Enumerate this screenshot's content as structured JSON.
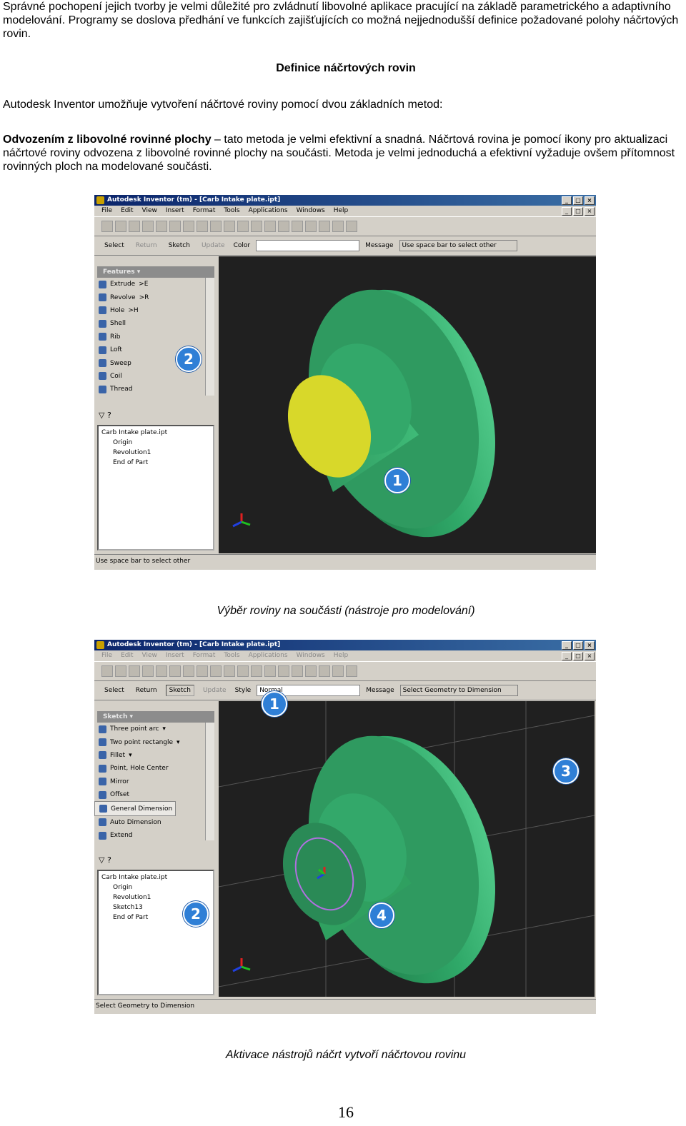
{
  "intro": "Správné pochopení jejich tvorby je velmi důležité pro zvládnutí libovolné aplikace pracující na základě parametrického a adaptivního modelování. Programy se doslova předhání ve funkcích zajišťujících co možná nejjednodušší definice požadované polohy náčrtových rovin.",
  "heading": "Definice náčrtových rovin",
  "para1": "Autodesk Inventor umožňuje vytvoření náčrtové roviny pomocí dvou základních metod:",
  "para2_bold": "Odvozením z libovolné rovinné plochy",
  "para2_rest": " – tato metoda je velmi efektivní a snadná. Náčrtová rovina je pomocí ikony pro aktualizaci náčrtové roviny odvozena z libovolné rovinné plochy na součásti. Metoda je velmi jednoduchá a efektivní vyžaduje ovšem přítomnost rovinných ploch na modelované součásti.",
  "caption1": "Výběr roviny na součásti (nástroje pro modelování)",
  "caption2": "Aktivace nástrojů náčrt vytvoří náčrtovou rovinu",
  "page_number": "16",
  "window_title": "Autodesk Inventor (tm) - [Carb Intake plate.ipt]",
  "menu": [
    "File",
    "Edit",
    "View",
    "Insert",
    "Format",
    "Tools",
    "Applications",
    "Windows",
    "Help"
  ],
  "shot1": {
    "select": "Select",
    "return": "Return",
    "sketch": "Sketch",
    "update": "Update",
    "style_label": "Color",
    "style_value": "",
    "message_label": "Message",
    "message": "Use space bar to select other",
    "panel_title": "Features ▾",
    "items": [
      {
        "label": "Extrude",
        "key": ">E"
      },
      {
        "label": "Revolve",
        "key": ">R"
      },
      {
        "label": "Hole",
        "key": ">H"
      },
      {
        "label": "Shell",
        "key": ""
      },
      {
        "label": "Rib",
        "key": ""
      },
      {
        "label": "Loft",
        "key": ""
      },
      {
        "label": "Sweep",
        "key": ""
      },
      {
        "label": "Coil",
        "key": ""
      },
      {
        "label": "Thread",
        "key": ""
      }
    ],
    "tree": [
      "Carb Intake plate.ipt",
      "Origin",
      "Revolution1",
      "End of Part"
    ],
    "status": "Use space bar to select other",
    "callouts": [
      "1",
      "2"
    ]
  },
  "shot2": {
    "select": "Select",
    "return": "Return",
    "sketch": "Sketch",
    "update": "Update",
    "style_label": "Style",
    "style_value": "Normal",
    "message_label": "Message",
    "message": "Select Geometry to Dimension",
    "panel_title": "Sketch ▾",
    "items": [
      {
        "label": "Three point arc",
        "key": "▾"
      },
      {
        "label": "Two point rectangle",
        "key": "▾"
      },
      {
        "label": "Fillet",
        "key": "▾"
      },
      {
        "label": "Point, Hole Center",
        "key": ""
      },
      {
        "label": "Mirror",
        "key": ""
      },
      {
        "label": "Offset",
        "key": ""
      },
      {
        "label": "General Dimension",
        "key": ""
      },
      {
        "label": "Auto Dimension",
        "key": ""
      },
      {
        "label": "Extend",
        "key": ""
      }
    ],
    "tree": [
      "Carb Intake plate.ipt",
      "Origin",
      "Revolution1",
      "Sketch13",
      "End of Part"
    ],
    "status": "Select Geometry to Dimension",
    "callouts": [
      "1",
      "2",
      "3",
      "4"
    ]
  },
  "colors": {
    "model_green": "#2fa868",
    "face_yellow": "#d8d82a",
    "callout_blue": "#2f7fd6",
    "viewport_bg": "#202020"
  }
}
